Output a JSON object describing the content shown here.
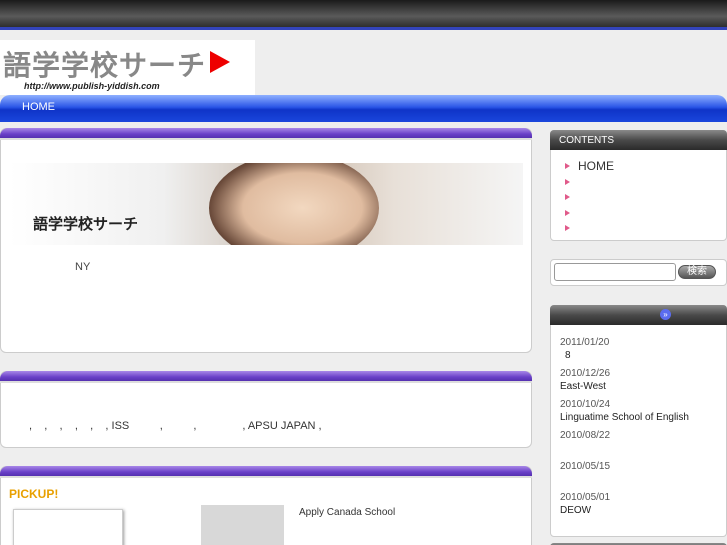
{
  "logo": {
    "title": "語学学校サーチ",
    "url": "http://www.publish-yiddish.com"
  },
  "nav": {
    "home": "HOME"
  },
  "main": {
    "banner_text": "語学学校サーチ",
    "intro_text": "NY"
  },
  "links_box": {
    "text": ",    ,    ,    ,    ,    , ISS          ,          ,               , APSU JAPAN ,"
  },
  "pickup": {
    "title": "PICKUP!",
    "item": "Apply Canada School"
  },
  "sidebar": {
    "contents_title": "CONTENTS",
    "menu": [
      "HOME",
      "",
      "",
      "",
      ""
    ],
    "search_placeholder": "",
    "search_button": "検索",
    "news_icon": "»",
    "news": [
      {
        "date": "2011/01/20",
        "text": "8"
      },
      {
        "date": "2010/12/26",
        "text": "East-West"
      },
      {
        "date": "2010/10/24",
        "text": "Linguatime School of English"
      },
      {
        "date": "2010/08/22",
        "text": ""
      },
      {
        "date": "2010/05/15",
        "text": ""
      },
      {
        "date": "2010/05/01",
        "text": "DEOW"
      }
    ]
  },
  "colors": {
    "nav_blue": "#1a46dc",
    "box_header_purple": "#6a40c8",
    "pickup_orange": "#e8a000",
    "menu_bullet": "#e05a8a"
  }
}
